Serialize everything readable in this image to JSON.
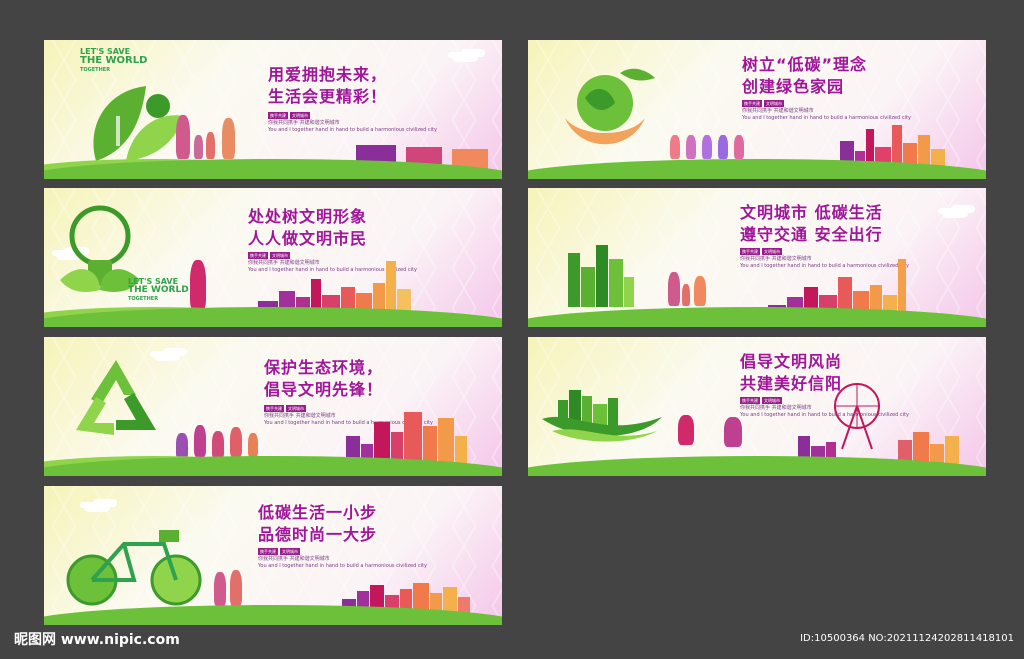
{
  "panels": [
    {
      "line1": "用爱拥抱未来，",
      "line2": "生活会更精彩！",
      "tags": [
        "携手共建",
        "文明城市"
      ],
      "sub1": "你我共同携手  共建和谐文明城市",
      "sub2": "You and I together hand in hand to build a harmonious civilized city",
      "logo": [
        "LET'S SAVE",
        "THE WORLD",
        "TOGETHER"
      ]
    },
    {
      "line1": "树立“低碳”理念",
      "line2": "创建绿色家园",
      "tags": [
        "携手共建",
        "文明城市"
      ],
      "sub1": "你我共同携手  共建和谐文明城市",
      "sub2": "You and I together hand in hand to build a harmonious civilized city"
    },
    {
      "line1": "处处树文明形象",
      "line2": "人人做文明市民",
      "tags": [
        "携手共建",
        "文明城市"
      ],
      "sub1": "你我共同携手  共建和谐文明城市",
      "sub2": "You and I together hand in hand to build a harmonious civilized city",
      "logo": [
        "LET'S SAVE",
        "THE WORLD",
        "TOGETHER"
      ]
    },
    {
      "line1": "文明城市  低碳生活",
      "line2": "遵守交通  安全出行",
      "tags": [
        "携手共建",
        "文明城市"
      ],
      "sub1": "你我共同携手  共建和谐文明城市",
      "sub2": "You and I together hand in hand to build a harmonious civilized city"
    },
    {
      "line1": "保护生态环境，",
      "line2": "倡导文明先锋！",
      "tags": [
        "携手共建",
        "文明城市"
      ],
      "sub1": "你我共同携手  共建和谐文明城市",
      "sub2": "You and I together hand in hand to build a harmonious civilized city"
    },
    {
      "line1": "倡导文明风尚",
      "line2": "共建美好信阳",
      "tags": [
        "携手共建",
        "文明城市"
      ],
      "sub1": "你我共同携手  共建和谐文明城市",
      "sub2": "You and I together hand in hand to build a harmonious civilized city"
    },
    {
      "line1": "低碳生活一小步",
      "line2": "品德时尚一大步",
      "tags": [
        "携手共建",
        "文明城市"
      ],
      "sub1": "你我共同携手  共建和谐文明城市",
      "sub2": "You and I together hand in hand to build a harmonious civilized city"
    }
  ],
  "footer": {
    "site": "昵图网 www.nipic.com",
    "id": "ID:10500364 NO:20211124202811418101"
  },
  "colors": {
    "background": "#444444",
    "headline": "#a0169a",
    "green": "#6cc03a",
    "magenta": "#c2185b"
  }
}
